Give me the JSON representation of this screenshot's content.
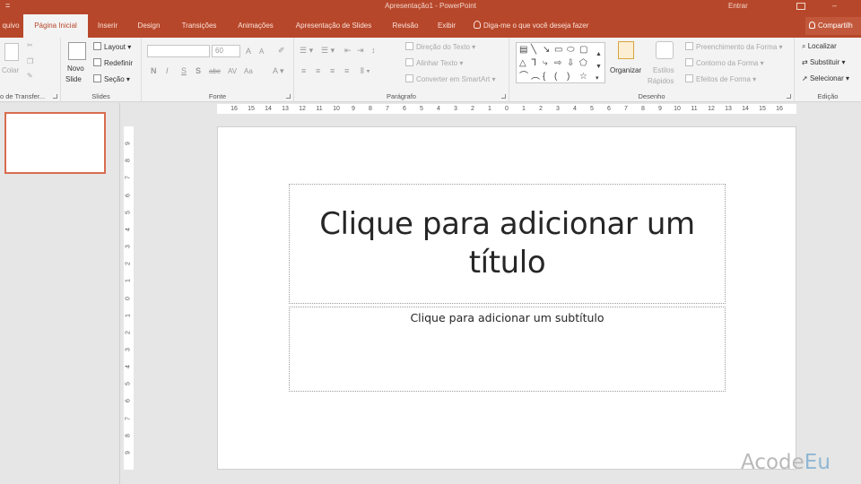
{
  "window": {
    "title": "Apresentação1 - PowerPoint",
    "sign_in": "Entrar",
    "qat_customize": "="
  },
  "tabs": [
    "quivo",
    "Página Inicial",
    "Inserir",
    "Design",
    "Transições",
    "Animações",
    "Apresentação de Slides",
    "Revisão",
    "Exibir"
  ],
  "active_tab": "Página Inicial",
  "tell_me": "Diga-me o que você deseja fazer",
  "share": "Compartilh",
  "ribbon": {
    "clipboard": {
      "paste": "Colar",
      "label": "o de Transfer..."
    },
    "slides": {
      "new_slide_1": "Novo",
      "new_slide_2": "Slide",
      "layout": "Layout",
      "reset": "Redefinir",
      "section": "Seção",
      "label": "Slides"
    },
    "font": {
      "font_name": "",
      "font_size": "60",
      "bold": "N",
      "italic": "I",
      "underline": "S",
      "shadow": "S",
      "strike": "abc",
      "spacing": "AV",
      "case": "Aa",
      "grow": "A",
      "shrink": "A",
      "label": "Fonte"
    },
    "paragraph": {
      "text_direction": "Direção do Texto",
      "align_text": "Alinhar Texto",
      "smartart": "Converter em SmartArt",
      "label": "Parágrafo"
    },
    "drawing": {
      "arrange": "Organizar",
      "quick_styles_1": "Estilos",
      "quick_styles_2": "Rápidos",
      "shape_fill": "Preenchimento da Forma",
      "shape_outline": "Contorno da Forma",
      "shape_effects": "Efeitos de Forma",
      "label": "Desenho"
    },
    "editing": {
      "find": "Localizar",
      "replace": "Substituir",
      "select": "Selecionar",
      "label": "Edição"
    }
  },
  "ruler": {
    "horizontal": [
      "16",
      "15",
      "14",
      "13",
      "12",
      "11",
      "10",
      "9",
      "8",
      "7",
      "6",
      "5",
      "4",
      "3",
      "2",
      "1",
      "0",
      "1",
      "2",
      "3",
      "4",
      "5",
      "6",
      "7",
      "8",
      "9",
      "10",
      "11",
      "12",
      "13",
      "14",
      "15",
      "16"
    ],
    "vertical": [
      "9",
      "8",
      "7",
      "6",
      "5",
      "4",
      "3",
      "2",
      "1",
      "0",
      "1",
      "2",
      "3",
      "4",
      "5",
      "6",
      "7",
      "8",
      "9"
    ]
  },
  "slide": {
    "title_placeholder": "Clique para adicionar um título",
    "subtitle_placeholder": "Clique para adicionar um subtítulo"
  },
  "thumbnails": {
    "count": 1,
    "current_number": "1"
  },
  "watermark": {
    "part1": "Acode",
    "part2": "Eu"
  },
  "colors": {
    "accent": "#b7472a",
    "ribbon_bg": "#f3f3f3",
    "workspace_bg": "#e6e6e6",
    "thumb_border": "#d86c4f"
  }
}
